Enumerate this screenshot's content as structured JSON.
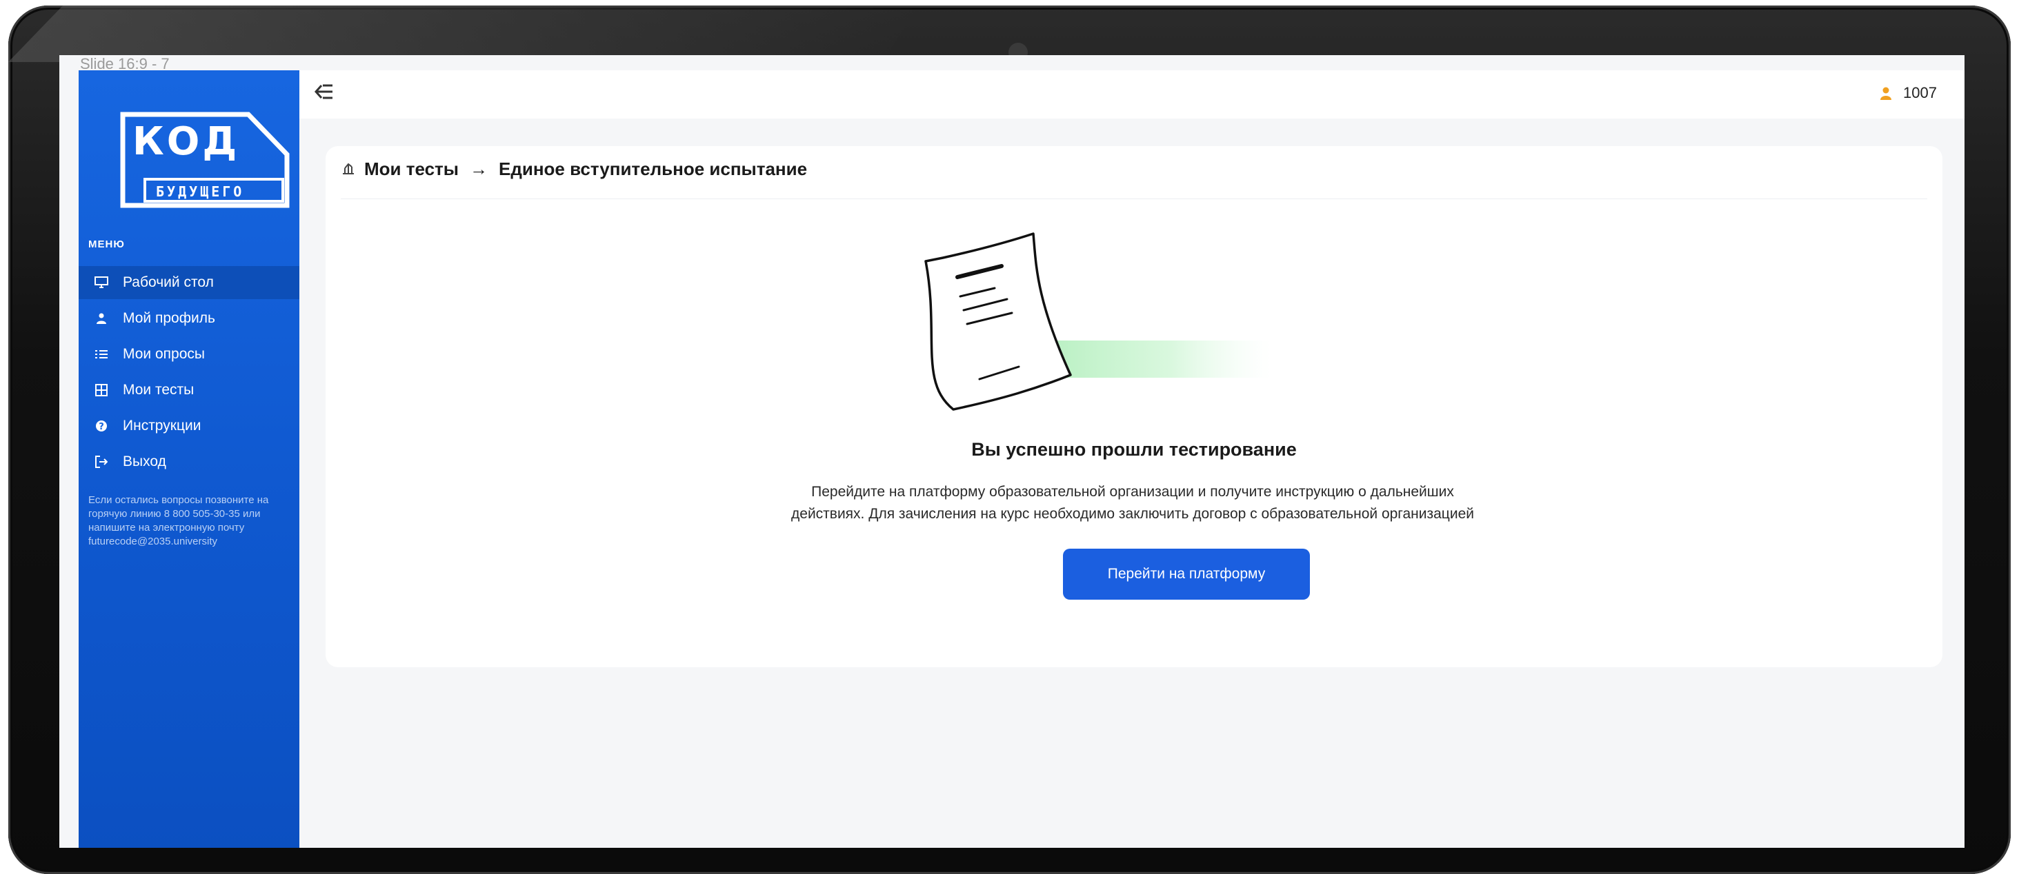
{
  "slide_label": "Slide 16:9 - 7",
  "logo": {
    "main": "КОД",
    "sub": "БУДУЩЕГО"
  },
  "sidebar": {
    "menu_title": "МЕНЮ",
    "items": [
      {
        "label": "Рабочий стол",
        "icon": "monitor-icon",
        "active": true
      },
      {
        "label": "Мой профиль",
        "icon": "user-icon",
        "active": false
      },
      {
        "label": "Мои опросы",
        "icon": "list-icon",
        "active": false
      },
      {
        "label": "Мои тесты",
        "icon": "grid-icon",
        "active": false
      },
      {
        "label": "Инструкции",
        "icon": "help-icon",
        "active": false
      },
      {
        "label": "Выход",
        "icon": "logout-icon",
        "active": false
      }
    ],
    "note": "Если остались вопросы позвоните на горячую линию 8 800 505-30-35 или напишите на электронную почту futurecode@2035.university"
  },
  "topbar": {
    "user_id": "1007"
  },
  "breadcrumb": {
    "first": "Мои тесты",
    "second": "Единое вступительное испытание"
  },
  "main": {
    "title": "Вы успешно прошли тестирование",
    "text": "Перейдите на платформу образовательной организации и получите инструкцию о дальнейших действиях. Для зачисления на курс необходимо заключить договор с образовательной организацией",
    "button_label": "Перейти на платформу"
  },
  "colors": {
    "sidebar": "#1766e0",
    "button": "#1b5fe0",
    "accent_user": "#f0a020",
    "green_trail": "#b9f2c3"
  }
}
